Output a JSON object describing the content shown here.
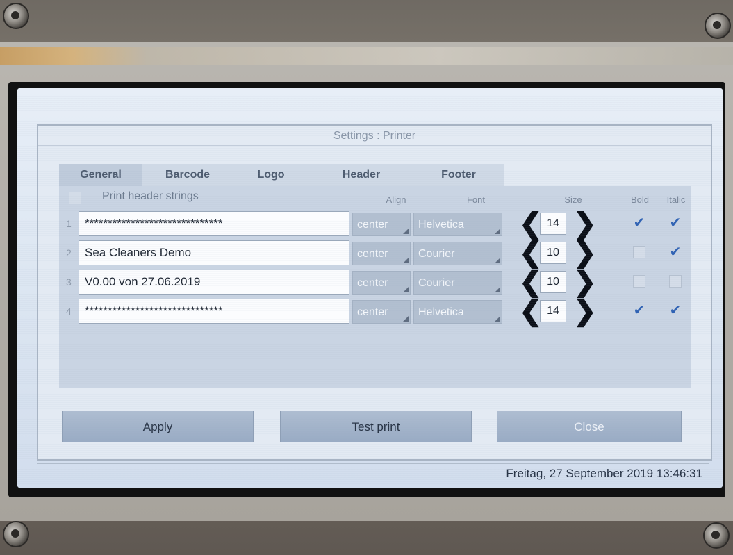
{
  "window": {
    "title": "Settings : Printer"
  },
  "tabs": [
    {
      "label": "General",
      "active": true
    },
    {
      "label": "Barcode",
      "active": false
    },
    {
      "label": "Logo",
      "active": false
    },
    {
      "label": "Header",
      "active": false
    },
    {
      "label": "Footer",
      "active": false
    }
  ],
  "header_strings": {
    "checkbox_label": "Print header strings",
    "columns": {
      "align": "Align",
      "font": "Font",
      "size": "Size",
      "bold": "Bold",
      "italic": "Italic"
    },
    "rows": [
      {
        "num": "1",
        "text": "******************************",
        "align": "center",
        "font": "Helvetica",
        "size": "14",
        "bold": true,
        "italic": true
      },
      {
        "num": "2",
        "text": "Sea Cleaners Demo",
        "align": "center",
        "font": "Courier",
        "size": "10",
        "bold": false,
        "italic": true
      },
      {
        "num": "3",
        "text": "V0.00 von 27.06.2019",
        "align": "center",
        "font": "Courier",
        "size": "10",
        "bold": false,
        "italic": false
      },
      {
        "num": "4",
        "text": "******************************",
        "align": "center",
        "font": "Helvetica",
        "size": "14",
        "bold": true,
        "italic": true
      }
    ]
  },
  "icons": {
    "decrease": "chevron-left-icon",
    "increase": "chevron-right-icon",
    "check": "checkmark-icon"
  },
  "buttons": {
    "apply": "Apply",
    "test_print": "Test print",
    "close": "Close"
  },
  "status": {
    "datetime": "Freitag, 27 September 2019 13:46:31"
  },
  "colors": {
    "screen_bg": "#dbe5f1",
    "button": "#a5b5cb",
    "check": "#2f62b4"
  }
}
